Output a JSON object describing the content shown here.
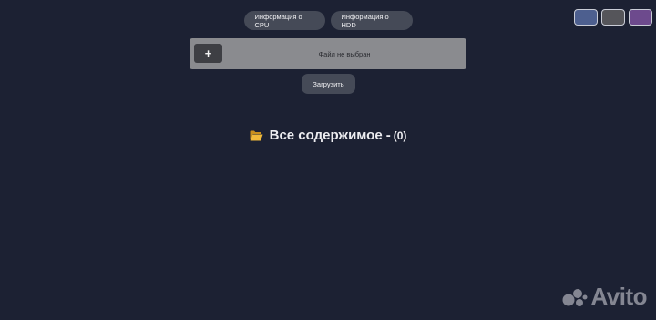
{
  "nav": {
    "cpu_label": "Информация о CPU",
    "hdd_label": "Информация о HDD"
  },
  "theme_swatches": [
    {
      "name": "blue",
      "color": "#4d5f8f"
    },
    {
      "name": "gray",
      "color": "#55555a"
    },
    {
      "name": "purple",
      "color": "#6d4a8d"
    }
  ],
  "upload": {
    "plus_label": "+",
    "file_status": "Файл не выбран",
    "submit_label": "Загрузить"
  },
  "content": {
    "icon": "open-folder-icon",
    "title": "Все содержимое",
    "separator": "-",
    "count": "(0)"
  },
  "watermark": {
    "icon": "avito-logo-icon",
    "text": "Avito"
  },
  "colors": {
    "background": "#1c2133",
    "button": "#454a57",
    "upload_bar": "#8a8b8f",
    "folder": "#f0b93a"
  }
}
